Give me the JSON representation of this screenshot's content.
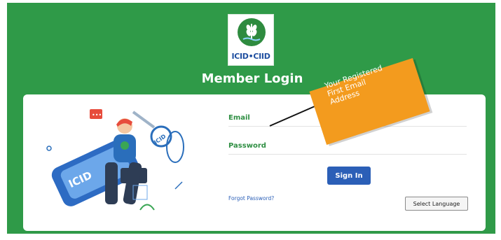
{
  "brand": {
    "logo_text": "ICID•CIID",
    "primary_color": "#2f9a48",
    "logo_text_color": "#1f4fa0"
  },
  "page": {
    "title": "Member Login"
  },
  "form": {
    "email_label": "Email",
    "email_value": "",
    "password_label": "Password",
    "password_value": "",
    "signin_label": "Sign In",
    "signin_color": "#2b5fb7",
    "forgot_password_label": "Forgot Password?",
    "language_button_label": "Select Language"
  },
  "callout": {
    "lines": [
      "Your Registered",
      "First Email",
      "Address"
    ],
    "color": "#f39b1e"
  },
  "illustration": {
    "device_label": "ICID",
    "key_label": "ICID"
  }
}
